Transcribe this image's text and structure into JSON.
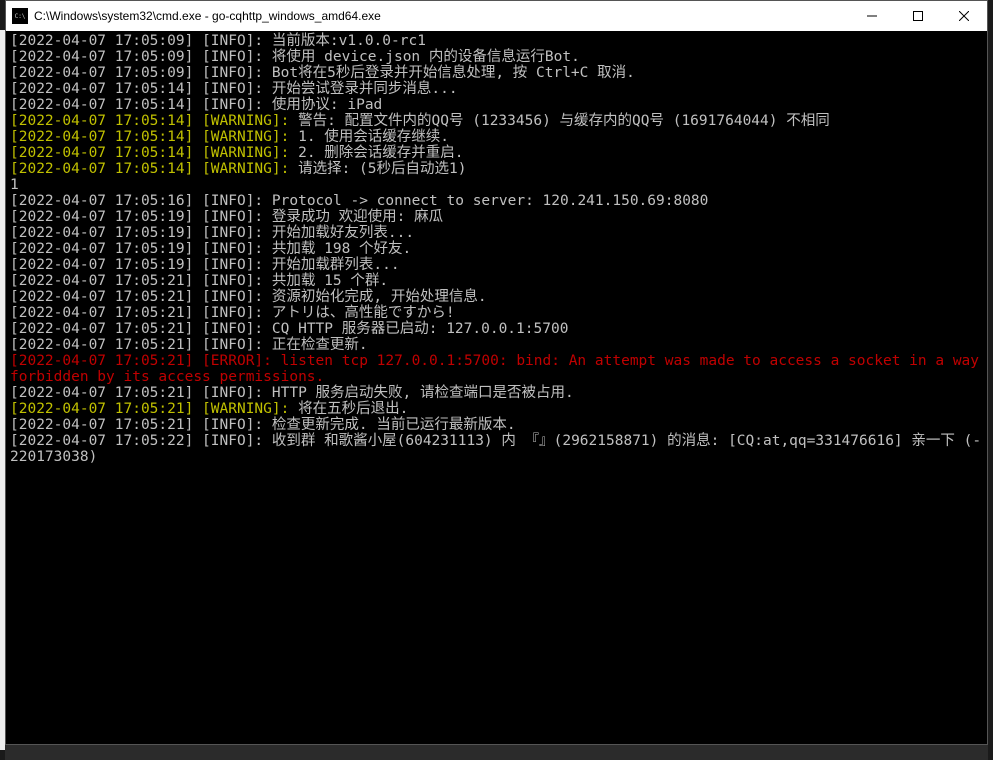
{
  "window": {
    "title": "C:\\Windows\\system32\\cmd.exe - go-cqhttp_windows_amd64.exe"
  },
  "lines": [
    {
      "level": "INFO",
      "ts": "2022-04-07 17:05:09",
      "msg": "当前版本:v1.0.0-rc1"
    },
    {
      "level": "INFO",
      "ts": "2022-04-07 17:05:09",
      "msg": "将使用 device.json 内的设备信息运行Bot."
    },
    {
      "level": "INFO",
      "ts": "2022-04-07 17:05:09",
      "msg": "Bot将在5秒后登录并开始信息处理, 按 Ctrl+C 取消."
    },
    {
      "level": "INFO",
      "ts": "2022-04-07 17:05:14",
      "msg": "开始尝试登录并同步消息..."
    },
    {
      "level": "INFO",
      "ts": "2022-04-07 17:05:14",
      "msg": "使用协议: iPad"
    },
    {
      "level": "WARNING",
      "ts": "2022-04-07 17:05:14",
      "msg": "警告: 配置文件内的QQ号 (1233456) 与缓存内的QQ号 (1691764044) 不相同"
    },
    {
      "level": "WARNING",
      "ts": "2022-04-07 17:05:14",
      "msg": "1. 使用会话缓存继续."
    },
    {
      "level": "WARNING",
      "ts": "2022-04-07 17:05:14",
      "msg": "2. 删除会话缓存并重启."
    },
    {
      "level": "WARNING",
      "ts": "2022-04-07 17:05:14",
      "msg": "请选择: (5秒后自动选1)"
    },
    {
      "level": "RAW",
      "msg": "1"
    },
    {
      "level": "INFO",
      "ts": "2022-04-07 17:05:16",
      "msg": "Protocol -> connect to server: 120.241.150.69:8080"
    },
    {
      "level": "INFO",
      "ts": "2022-04-07 17:05:19",
      "msg": "登录成功 欢迎使用: 麻瓜"
    },
    {
      "level": "INFO",
      "ts": "2022-04-07 17:05:19",
      "msg": "开始加载好友列表..."
    },
    {
      "level": "INFO",
      "ts": "2022-04-07 17:05:19",
      "msg": "共加载 198 个好友."
    },
    {
      "level": "INFO",
      "ts": "2022-04-07 17:05:19",
      "msg": "开始加载群列表..."
    },
    {
      "level": "INFO",
      "ts": "2022-04-07 17:05:21",
      "msg": "共加载 15 个群."
    },
    {
      "level": "INFO",
      "ts": "2022-04-07 17:05:21",
      "msg": "资源初始化完成, 开始处理信息."
    },
    {
      "level": "INFO",
      "ts": "2022-04-07 17:05:21",
      "msg": "アトリは、高性能ですから!"
    },
    {
      "level": "INFO",
      "ts": "2022-04-07 17:05:21",
      "msg": "CQ HTTP 服务器已启动: 127.0.0.1:5700"
    },
    {
      "level": "INFO",
      "ts": "2022-04-07 17:05:21",
      "msg": "正在检查更新."
    },
    {
      "level": "ERROR",
      "ts": "2022-04-07 17:05:21",
      "msg": "listen tcp 127.0.0.1:5700: bind: An attempt was made to access a socket in a way forbidden by its access permissions."
    },
    {
      "level": "INFO",
      "ts": "2022-04-07 17:05:21",
      "msg": "HTTP 服务启动失败, 请检查端口是否被占用."
    },
    {
      "level": "WARNING",
      "ts": "2022-04-07 17:05:21",
      "msg": "将在五秒后退出."
    },
    {
      "level": "INFO",
      "ts": "2022-04-07 17:05:21",
      "msg": "检查更新完成. 当前已运行最新版本."
    },
    {
      "level": "INFO",
      "ts": "2022-04-07 17:05:22",
      "msg": "收到群 和歌酱小屋(604231113) 内 『』(2962158871) 的消息: [CQ:at,qq=331476616] 亲一下 (-220173038)"
    }
  ]
}
